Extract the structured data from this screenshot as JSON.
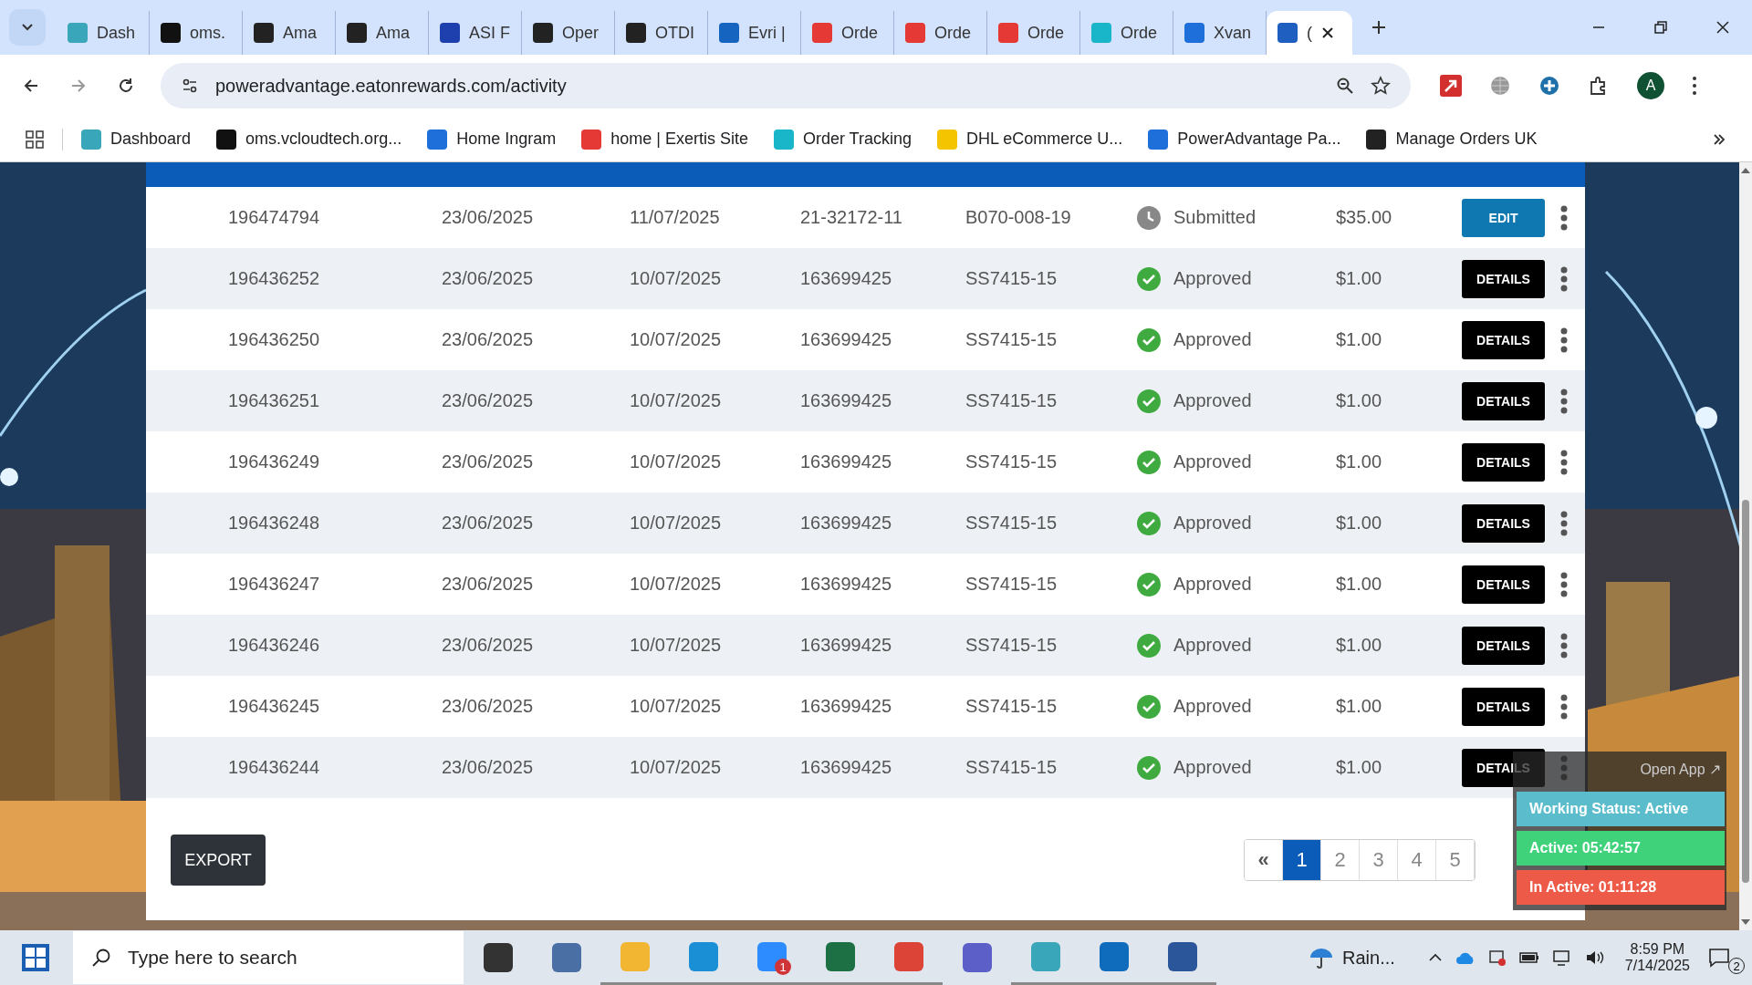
{
  "tabs": [
    {
      "label": "Dash",
      "selected": false
    },
    {
      "label": "oms.",
      "selected": false
    },
    {
      "label": "Ama",
      "selected": false
    },
    {
      "label": "Ama",
      "selected": false
    },
    {
      "label": "ASI F",
      "selected": false
    },
    {
      "label": "Oper",
      "selected": false
    },
    {
      "label": "OTDI",
      "selected": false
    },
    {
      "label": "Evri |",
      "selected": false
    },
    {
      "label": "Orde",
      "selected": false
    },
    {
      "label": "Orde",
      "selected": false
    },
    {
      "label": "Orde",
      "selected": false
    },
    {
      "label": "Orde",
      "selected": false
    },
    {
      "label": "Xvan",
      "selected": false
    },
    {
      "label": "(",
      "selected": true
    }
  ],
  "url": "poweradvantage.eatonrewards.com/activity",
  "profile_initial": "A",
  "bookmarks": [
    "Dashboard",
    "oms.vcloudtech.org...",
    "Home Ingram",
    "home | Exertis Site",
    "Order Tracking",
    "DHL eCommerce U...",
    "PowerAdvantage Pa...",
    "Manage Orders UK"
  ],
  "rows": [
    {
      "id": "196474794",
      "date_1": "23/06/2025",
      "date_2": "11/07/2025",
      "reference": "21-32172-11",
      "part": "B070-008-19",
      "status": "Submitted",
      "kind": "pending",
      "amount": "$35.00",
      "action": "EDIT"
    },
    {
      "id": "196436252",
      "date_1": "23/06/2025",
      "date_2": "10/07/2025",
      "reference": "163699425",
      "part": "SS7415-15",
      "status": "Approved",
      "kind": "approved",
      "amount": "$1.00",
      "action": "DETAILS"
    },
    {
      "id": "196436250",
      "date_1": "23/06/2025",
      "date_2": "10/07/2025",
      "reference": "163699425",
      "part": "SS7415-15",
      "status": "Approved",
      "kind": "approved",
      "amount": "$1.00",
      "action": "DETAILS"
    },
    {
      "id": "196436251",
      "date_1": "23/06/2025",
      "date_2": "10/07/2025",
      "reference": "163699425",
      "part": "SS7415-15",
      "status": "Approved",
      "kind": "approved",
      "amount": "$1.00",
      "action": "DETAILS"
    },
    {
      "id": "196436249",
      "date_1": "23/06/2025",
      "date_2": "10/07/2025",
      "reference": "163699425",
      "part": "SS7415-15",
      "status": "Approved",
      "kind": "approved",
      "amount": "$1.00",
      "action": "DETAILS"
    },
    {
      "id": "196436248",
      "date_1": "23/06/2025",
      "date_2": "10/07/2025",
      "reference": "163699425",
      "part": "SS7415-15",
      "status": "Approved",
      "kind": "approved",
      "amount": "$1.00",
      "action": "DETAILS"
    },
    {
      "id": "196436247",
      "date_1": "23/06/2025",
      "date_2": "10/07/2025",
      "reference": "163699425",
      "part": "SS7415-15",
      "status": "Approved",
      "kind": "approved",
      "amount": "$1.00",
      "action": "DETAILS"
    },
    {
      "id": "196436246",
      "date_1": "23/06/2025",
      "date_2": "10/07/2025",
      "reference": "163699425",
      "part": "SS7415-15",
      "status": "Approved",
      "kind": "approved",
      "amount": "$1.00",
      "action": "DETAILS"
    },
    {
      "id": "196436245",
      "date_1": "23/06/2025",
      "date_2": "10/07/2025",
      "reference": "163699425",
      "part": "SS7415-15",
      "status": "Approved",
      "kind": "approved",
      "amount": "$1.00",
      "action": "DETAILS"
    },
    {
      "id": "196436244",
      "date_1": "23/06/2025",
      "date_2": "10/07/2025",
      "reference": "163699425",
      "part": "SS7415-15",
      "status": "Approved",
      "kind": "approved",
      "amount": "$1.00",
      "action": "DETAILS"
    }
  ],
  "export_label": "EXPORT",
  "pagination": {
    "previous": "«",
    "pages": [
      {
        "label": "1",
        "selected": true
      },
      {
        "label": "2",
        "selected": false
      },
      {
        "label": "3",
        "selected": false
      },
      {
        "label": "4",
        "selected": false
      },
      {
        "label": "5",
        "selected": false
      }
    ]
  },
  "tracker": {
    "open_app": "Open App ↗",
    "lines": [
      {
        "text": "Working Status: Active",
        "color": "#5bbccc"
      },
      {
        "text": "Active: 05:42:57",
        "color": "#3fd27a"
      },
      {
        "text": "In Active: 01:11:28",
        "color": "#ee5a48"
      }
    ]
  },
  "taskbar": {
    "search_placeholder": "Type here to search",
    "apps": [
      {
        "active": false
      },
      {
        "active": false
      },
      {
        "active": true
      },
      {
        "active": true
      },
      {
        "active": true,
        "badge": "1"
      },
      {
        "active": true
      },
      {
        "active": true
      },
      {
        "active": false
      },
      {
        "active": true
      },
      {
        "active": true
      },
      {
        "active": true
      }
    ],
    "weather": "Rain...",
    "time": "8:59 PM",
    "date": "7/14/2025",
    "notifications": "2"
  }
}
